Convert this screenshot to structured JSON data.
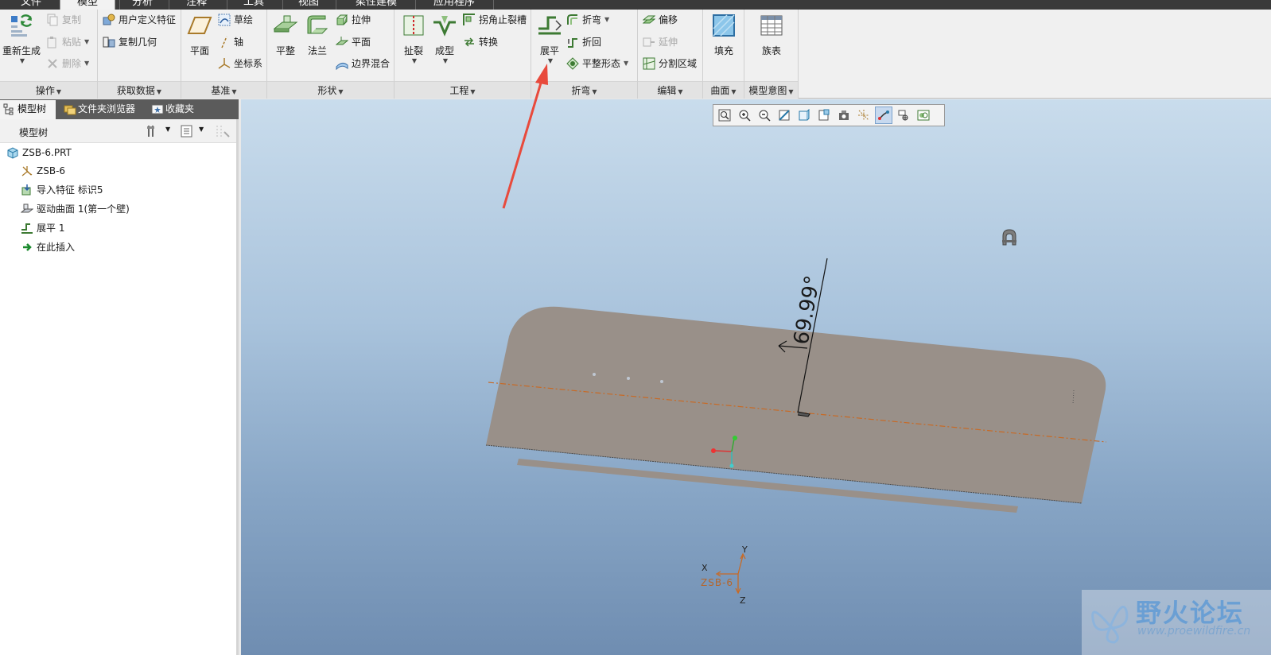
{
  "tabs": [
    "文件",
    "模型",
    "分析",
    "注释",
    "工具",
    "视图",
    "柔性建模",
    "应用程序"
  ],
  "active_tab": "模型",
  "ribbon": {
    "operations": {
      "label": "操作",
      "regenerate": "重新生成",
      "copy": "复制",
      "paste": "粘贴",
      "delete": "删除"
    },
    "get_data": {
      "label": "获取数据",
      "udf": "用户定义特征",
      "copy_geometry": "复制几何"
    },
    "datum": {
      "label": "基准",
      "plane": "平面",
      "sketch": "草绘",
      "axis": "轴",
      "csys": "坐标系"
    },
    "shapes": {
      "label": "形状",
      "planar": "平整",
      "flange": "法兰",
      "extrude": "拉伸",
      "flat": "平面",
      "blend": "边界混合"
    },
    "engineering": {
      "label": "工程",
      "rip": "扯裂",
      "form": "成型",
      "corner_relief": "拐角止裂槽",
      "convert": "转换"
    },
    "bends": {
      "label": "折弯",
      "unbend": "展平",
      "bend": "折弯",
      "bend_back": "折回",
      "flat_pattern": "平整形态"
    },
    "editing": {
      "label": "编辑",
      "offset": "偏移",
      "extend": "延伸",
      "split_area": "分割区域"
    },
    "surfaces": {
      "label": "曲面",
      "fill": "填充"
    },
    "model_intent": {
      "label": "模型意图",
      "family_table": "族表"
    }
  },
  "left_panel": {
    "tabs": [
      "模型树",
      "文件夹浏览器",
      "收藏夹"
    ],
    "header": "模型树",
    "tree": [
      {
        "label": "ZSB-6.PRT",
        "icon": "part-icon"
      },
      {
        "label": "ZSB-6",
        "icon": "csys-icon"
      },
      {
        "label": "导入特征 标识5",
        "icon": "import-feature-icon"
      },
      {
        "label": "驱动曲面 1(第一个壁)",
        "icon": "driving-surface-icon"
      },
      {
        "label": "展平 1",
        "icon": "unbend-icon"
      },
      {
        "label": "在此插入",
        "icon": "insert-here-arrow-icon"
      }
    ]
  },
  "viewport": {
    "dimension_text": "69.99°",
    "csys_label": "ZSB-6",
    "axis_x": "X",
    "axis_y": "Y",
    "axis_z": "Z",
    "colors": {
      "part": "#999089",
      "arrow": "#e84a3c"
    }
  },
  "watermark": {
    "title": "野火论坛",
    "url": "www.proewildfire.cn"
  }
}
